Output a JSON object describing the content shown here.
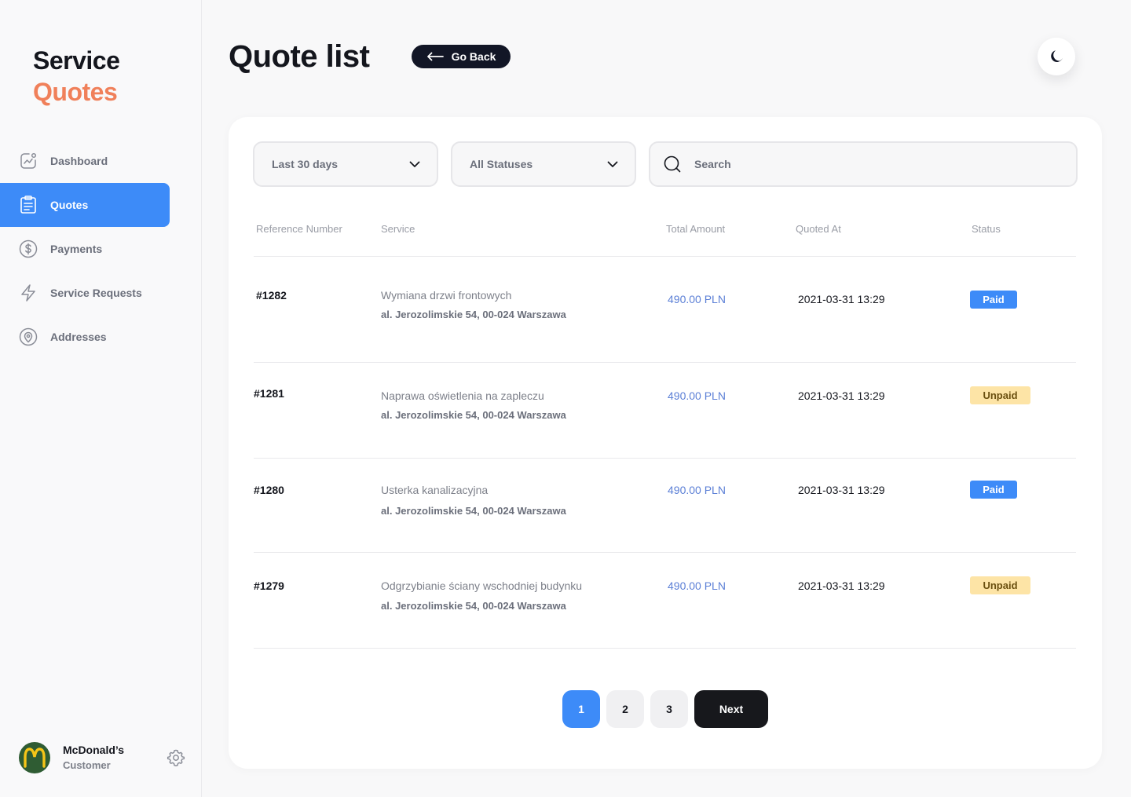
{
  "brand": {
    "line1": "Service",
    "line2": "Quotes",
    "accent": "#f0805a"
  },
  "sidebar": {
    "items": [
      {
        "label": "Dashboard",
        "icon": "chart-icon"
      },
      {
        "label": "Quotes",
        "icon": "clipboard-icon",
        "active": true
      },
      {
        "label": "Payments",
        "icon": "dollar-icon"
      },
      {
        "label": "Service Requests",
        "icon": "lightning-icon"
      },
      {
        "label": "Addresses",
        "icon": "map-pin-icon"
      }
    ]
  },
  "user": {
    "name": "McDonald’s",
    "role": "Customer"
  },
  "header": {
    "title": "Quote list",
    "back_label": "Go Back"
  },
  "filters": {
    "date_range": "Last 30 days",
    "status": "All Statuses",
    "search_placeholder": "Search"
  },
  "table": {
    "columns": [
      "Reference Number",
      "Service",
      "Total Amount",
      "Quoted At",
      "Status"
    ],
    "rows": [
      {
        "ref": "#1282",
        "service": "Wymiana drzwi frontowych",
        "address": "al. Jerozolimskie 54, 00-024 Warszawa",
        "amount": "490.00 PLN",
        "quoted_at": "2021-03-31 13:29",
        "status": "Paid"
      },
      {
        "ref": "#1281",
        "service": "Naprawa oświetlenia na zapleczu",
        "address": "al. Jerozolimskie 54, 00-024 Warszawa",
        "amount": "490.00 PLN",
        "quoted_at": "2021-03-31 13:29",
        "status": "Unpaid"
      },
      {
        "ref": "#1280",
        "service": "Usterka kanalizacyjna",
        "address": "al. Jerozolimskie 54, 00-024 Warszawa",
        "amount": "490.00 PLN",
        "quoted_at": "2021-03-31 13:29",
        "status": "Paid"
      },
      {
        "ref": "#1279",
        "service": "Odgrzybianie ściany wschodniej budynku",
        "address": "al. Jerozolimskie 54, 00-024 Warszawa",
        "amount": "490.00 PLN",
        "quoted_at": "2021-03-31 13:29",
        "status": "Unpaid"
      }
    ]
  },
  "pagination": {
    "pages": [
      "1",
      "2",
      "3"
    ],
    "current": "1",
    "next_label": "Next"
  },
  "colors": {
    "primary": "#3d8bf8",
    "dark": "#121626",
    "paid_bg": "#3d8bf8",
    "unpaid_bg": "#fde4a6",
    "amount": "#5b7fd6"
  }
}
